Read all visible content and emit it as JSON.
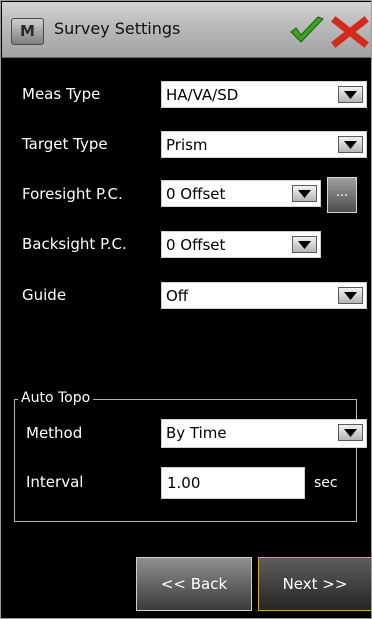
{
  "window": {
    "logo_letter": "M",
    "title": "Survey Settings",
    "ok_icon": "check-icon",
    "cancel_icon": "close-icon",
    "colors": {
      "ok": "#3aa321",
      "cancel": "#d42a1e",
      "accent": "#e0a62c"
    }
  },
  "fields": {
    "meas_type": {
      "label": "Meas Type",
      "value": "HA/VA/SD"
    },
    "target_type": {
      "label": "Target Type",
      "value": "Prism"
    },
    "foresight_pc": {
      "label": "Foresight P.C.",
      "value": "0 Offset",
      "button": "..."
    },
    "backsight_pc": {
      "label": "Backsight P.C.",
      "value": "0 Offset"
    },
    "guide": {
      "label": "Guide",
      "value": "Off"
    }
  },
  "auto_topo": {
    "legend": "Auto Topo",
    "method": {
      "label": "Method",
      "value": "By Time"
    },
    "interval": {
      "label": "Interval",
      "value": "1.00",
      "unit": "sec"
    }
  },
  "nav": {
    "back_label": "<< Back",
    "next_label": "Next >>"
  }
}
